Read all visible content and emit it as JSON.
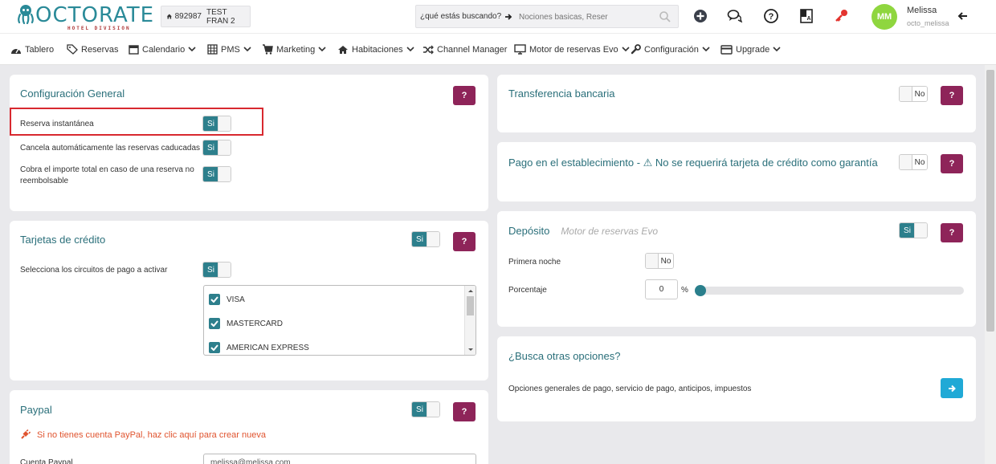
{
  "header": {
    "logo_text": "OCTORATE",
    "logo_sub": "HOTEL DIVISION",
    "property_id": "892987",
    "property_name": "TEST FRAN 2",
    "search_label": "¿qué estás buscando?",
    "search_placeholder": "Nociones basicas, Reser",
    "user_initials": "MM",
    "user_name": "Melissa",
    "user_handle": "octo_melissa"
  },
  "nav": {
    "items": [
      {
        "label": "Tablero",
        "icon": "dashboard-icon"
      },
      {
        "label": "Reservas",
        "icon": "tag-icon"
      },
      {
        "label": "Calendario",
        "icon": "calendar-icon"
      },
      {
        "label": "PMS",
        "icon": "pms-icon"
      },
      {
        "label": "Marketing",
        "icon": "cart-icon"
      },
      {
        "label": "Habitaciones",
        "icon": "home-icon"
      },
      {
        "label": "Channel Manager",
        "icon": "shuffle-icon"
      },
      {
        "label": "Motor de reservas Evo",
        "icon": "monitor-icon"
      },
      {
        "label": "Configuración",
        "icon": "wrench-icon"
      },
      {
        "label": "Upgrade",
        "icon": "card-icon"
      }
    ]
  },
  "general": {
    "title": "Configuración General",
    "help": "?",
    "rows": [
      {
        "label": "Reserva instantánea",
        "toggle": "Si"
      },
      {
        "label": "Cancela automáticamente las reservas caducadas",
        "toggle": "Si"
      },
      {
        "label_line1": "Cobra el importe total en caso de una reserva no",
        "label_line2": "reembolsable",
        "toggle": "Si"
      }
    ]
  },
  "cards_section": {
    "title": "Tarjetas de crédito",
    "toggle": "Si",
    "help": "?",
    "circuits_label": "Selecciona los circuitos de pago a activar",
    "circuits_toggle": "Si",
    "options": [
      "VISA",
      "MASTERCARD",
      "AMERICAN EXPRESS"
    ]
  },
  "paypal": {
    "title": "Paypal",
    "toggle": "Si",
    "help": "?",
    "link": "Si no tienes cuenta PayPal, haz clic aquí para crear nueva",
    "account_label": "Cuenta Paypal",
    "account_value": "melissa@melissa.com"
  },
  "bank_transfer": {
    "title": "Transferencia bancaria",
    "toggle": "No",
    "help": "?"
  },
  "pay_at_property": {
    "title": "Pago en el establecimiento - ⚠ No se requerirá tarjeta de crédito como garantía",
    "toggle": "No",
    "help": "?"
  },
  "deposit": {
    "title": "Depósito",
    "subtitle": "Motor de reservas Evo",
    "toggle": "Si",
    "help": "?",
    "first_night_label": "Primera noche",
    "first_night_toggle": "No",
    "percent_label": "Porcentaje",
    "percent_value": "0",
    "percent_unit": "%",
    "slider_value_percent": 0
  },
  "other_options": {
    "title": "¿Busca otras opciones?",
    "description": "Opciones generales de pago, servicio de pago, anticipos, impuestos"
  },
  "colors": {
    "accent": "#2d7f8c",
    "help_button": "#8e2459",
    "highlight": "#d8282f",
    "go_button": "#20a9d6",
    "warning_link": "#e0542f"
  }
}
